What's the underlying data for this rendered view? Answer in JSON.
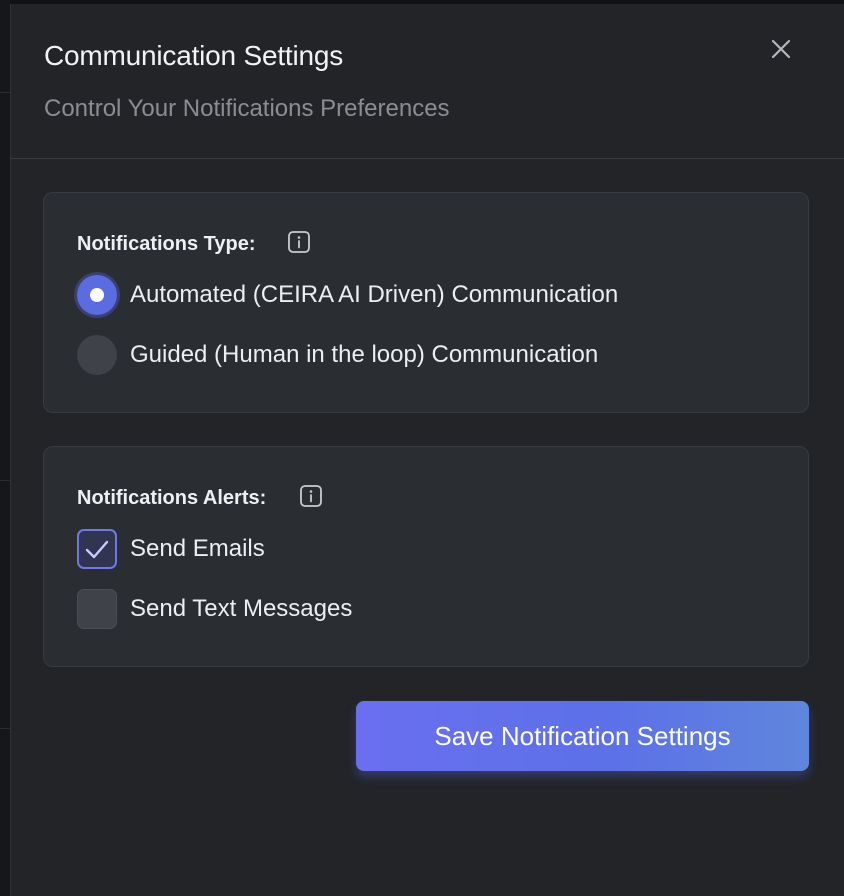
{
  "dialog": {
    "title": "Communication Settings",
    "subtitle": "Control Your Notifications Preferences",
    "close_icon": "close-icon"
  },
  "notification_type": {
    "label": "Notifications Type:",
    "info_icon": "info-icon",
    "options": [
      {
        "label": "Automated (CEIRA AI Driven) Communication",
        "selected": true
      },
      {
        "label": "Guided (Human in the loop) Communication",
        "selected": false
      }
    ]
  },
  "notification_alerts": {
    "label": "Notifications Alerts:",
    "info_icon": "info-icon",
    "options": [
      {
        "label": "Send Emails",
        "checked": true
      },
      {
        "label": "Send Text Messages",
        "checked": false
      }
    ]
  },
  "save_button": {
    "label": "Save Notification Settings"
  },
  "colors": {
    "accent": "#5b6ce0",
    "panel_bg": "#222428",
    "card_bg": "#2a2d32"
  }
}
